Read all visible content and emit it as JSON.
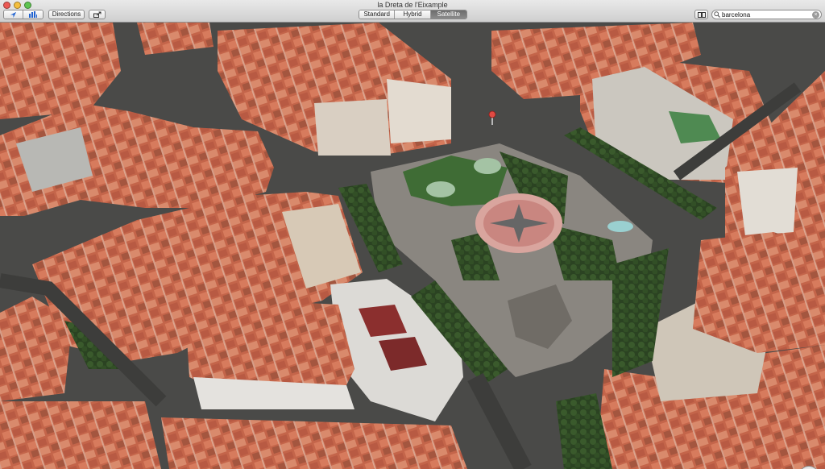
{
  "window": {
    "title": "la Dreta de l'Eixample"
  },
  "toolbar": {
    "location_icon": "location-arrow-icon",
    "bars_icon": "3d-buildings-icon",
    "directions_label": "Directions",
    "share_icon": "share-icon",
    "bookmark_icon": "bookmarks-book-icon",
    "view_modes": [
      {
        "label": "Standard",
        "active": false
      },
      {
        "label": "Hybrid",
        "active": false
      },
      {
        "label": "Satellite",
        "active": true
      }
    ]
  },
  "search": {
    "value": "barcelona",
    "icon": "search-icon",
    "clear_icon": "clear-icon"
  },
  "map": {
    "zoom_out_label": "−",
    "zoom_in_label": "+",
    "compass_icon": "compass-icon",
    "pin_icon": "red-pin-icon",
    "colors": {
      "roof": "#c9694a",
      "plaza": "#8a8680",
      "road": "#4a4a4a",
      "tree": "#2f4a24",
      "accent": "#e14a43"
    }
  }
}
